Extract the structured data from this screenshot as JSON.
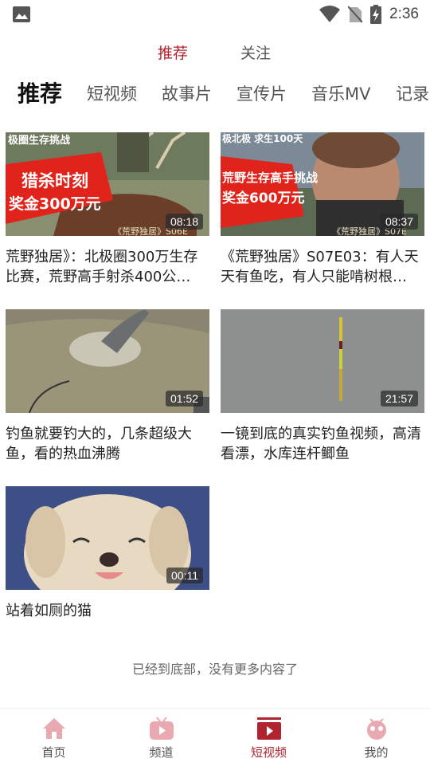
{
  "status_bar": {
    "time": "2:36",
    "icons": [
      "gallery-icon",
      "wifi-icon",
      "no-sim-icon",
      "battery-charging-icon"
    ]
  },
  "top_tabs": [
    {
      "label": "推荐",
      "active": true
    },
    {
      "label": "关注",
      "active": false
    }
  ],
  "categories": [
    {
      "label": "推荐",
      "active": true
    },
    {
      "label": "短视频"
    },
    {
      "label": "故事片"
    },
    {
      "label": "宣传片"
    },
    {
      "label": "音乐MV"
    },
    {
      "label": "记录"
    }
  ],
  "videos": [
    {
      "title": "荒野独居》：北极圈300万生存比赛，荒野高手射杀400公…",
      "duration": "08:18",
      "thumb_texts": [
        "极圈生存挑战",
        "猎杀时刻",
        "奖金300万元",
        "《荒野独居》S06E"
      ]
    },
    {
      "title": "《荒野独居》S07E03：有人天天有鱼吃，有人只能啃树根…",
      "duration": "08:37",
      "thumb_texts": [
        "极北极 求生100天",
        "荒野生存高手挑战",
        "奖金600万元",
        "《荒野独居》S07E"
      ]
    },
    {
      "title": "钓鱼就要钓大的，几条超级大鱼，看的热血沸腾",
      "duration": "01:52"
    },
    {
      "title": "一镜到底的真实钓鱼视频，高清看漂，水库连杆鲫鱼",
      "duration": "21:57"
    },
    {
      "title": "站着如厕的猫",
      "duration": "00:11"
    }
  ],
  "end_text": "已经到底部，没有更多内容了",
  "bottom_nav": [
    {
      "label": "首页",
      "icon": "home-icon",
      "active": false
    },
    {
      "label": "频道",
      "icon": "channel-tv-icon",
      "active": false
    },
    {
      "label": "短视频",
      "icon": "short-video-icon",
      "active": true
    },
    {
      "label": "我的",
      "icon": "profile-icon",
      "active": false
    }
  ],
  "colors": {
    "accent": "#b0242f",
    "nav_inactive_icon": "#e8aab0"
  }
}
